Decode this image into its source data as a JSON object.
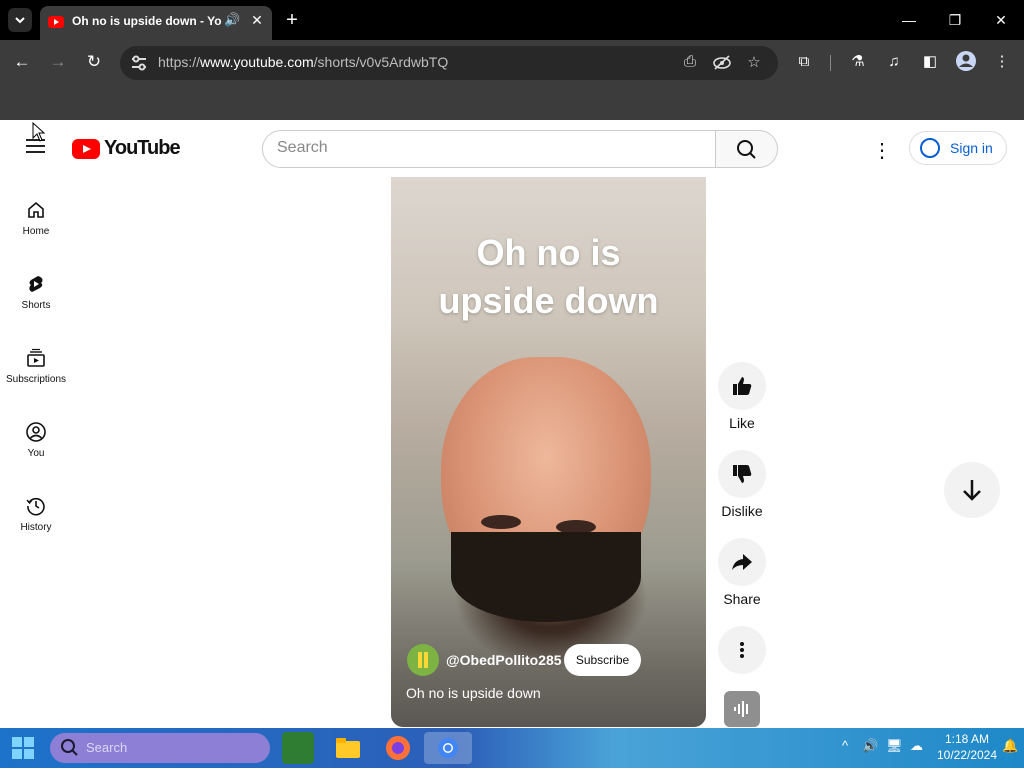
{
  "browser": {
    "tab_title": "Oh no is upside down - YouTube",
    "url_prefix": "https://",
    "url_host": "www.youtube.com",
    "url_path": "/shorts/v0v5ArdwbTQ"
  },
  "youtube": {
    "logo_text": "YouTube",
    "search_placeholder": "Search",
    "signin_label": "Sign in",
    "sidebar": [
      {
        "label": "Home",
        "icon": "home-icon"
      },
      {
        "label": "Shorts",
        "icon": "shorts-icon"
      },
      {
        "label": "Subscriptions",
        "icon": "subscriptions-icon"
      },
      {
        "label": "You",
        "icon": "you-icon"
      },
      {
        "label": "History",
        "icon": "history-icon"
      }
    ]
  },
  "short": {
    "overlay_title_line1": "Oh no is",
    "overlay_title_line2": "upside down",
    "channel": "@ObedPollito285",
    "subscribe_label": "Subscribe",
    "caption": "Oh no is upside down",
    "actions": {
      "like": "Like",
      "dislike": "Dislike",
      "share": "Share"
    }
  },
  "taskbar": {
    "search_placeholder": "Search",
    "time": "1:18 AM",
    "date": "10/22/2024"
  }
}
